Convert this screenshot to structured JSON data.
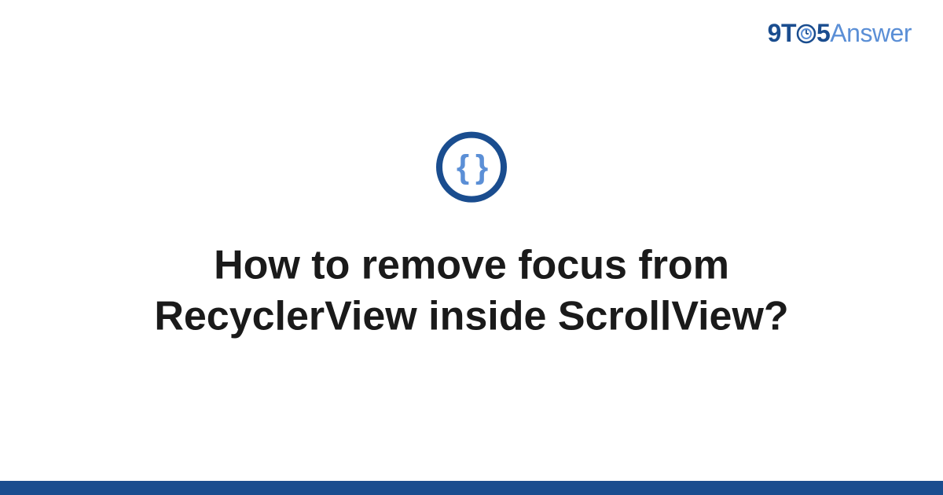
{
  "brand": {
    "part1": "9T",
    "part2": "5",
    "part3": "Answer"
  },
  "category": {
    "icon_name": "code-braces-icon",
    "symbol": "{ }"
  },
  "question": {
    "title": "How to remove focus from RecyclerView inside ScrollView?"
  },
  "colors": {
    "primary": "#1a4d8f",
    "secondary": "#5b8fd6"
  }
}
